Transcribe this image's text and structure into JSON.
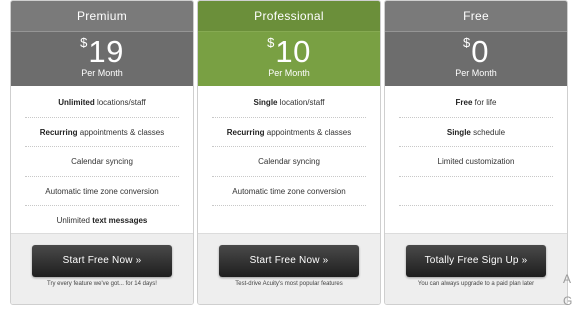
{
  "plans": [
    {
      "name": "Premium",
      "currency": "$",
      "amount": "19",
      "period": "Per Month",
      "features": [
        {
          "bold": "Unlimited",
          "text": " locations/staff"
        },
        {
          "bold": "Recurring",
          "text": " appointments & classes"
        },
        {
          "bold": "",
          "text": "Calendar syncing"
        },
        {
          "bold": "",
          "text": "Automatic time zone conversion"
        },
        {
          "prefix": "Unlimited ",
          "bold_end": "text messages"
        }
      ],
      "cta": "Start Free Now »",
      "note": "Try every feature we've got... for 14 days!"
    },
    {
      "name": "Professional",
      "currency": "$",
      "amount": "10",
      "period": "Per Month",
      "features": [
        {
          "bold": "Single",
          "text": " location/staff"
        },
        {
          "bold": "Recurring",
          "text": " appointments & classes"
        },
        {
          "bold": "",
          "text": "Calendar syncing"
        },
        {
          "bold": "",
          "text": "Automatic time zone conversion"
        },
        {
          "bold": "",
          "text": ""
        }
      ],
      "cta": "Start Free Now »",
      "note": "Test-drive Acuity's most popular features"
    },
    {
      "name": "Free",
      "currency": "$",
      "amount": "0",
      "period": "Per Month",
      "features": [
        {
          "bold": "Free",
          "text": " for life"
        },
        {
          "bold": "Single",
          "text": " schedule"
        },
        {
          "bold": "",
          "text": "Limited customization"
        },
        {
          "bold": "",
          "text": ""
        },
        {
          "bold": "",
          "text": ""
        }
      ],
      "cta": "Totally Free Sign Up »",
      "note": "You can always upgrade to a paid plan later"
    }
  ],
  "side_letters": [
    "A",
    "G"
  ],
  "colors": {
    "premium_header": "#7a7a7a",
    "professional_header": "#6b8f3a",
    "professional_price": "#79a043",
    "button": "#1e1e1e"
  }
}
